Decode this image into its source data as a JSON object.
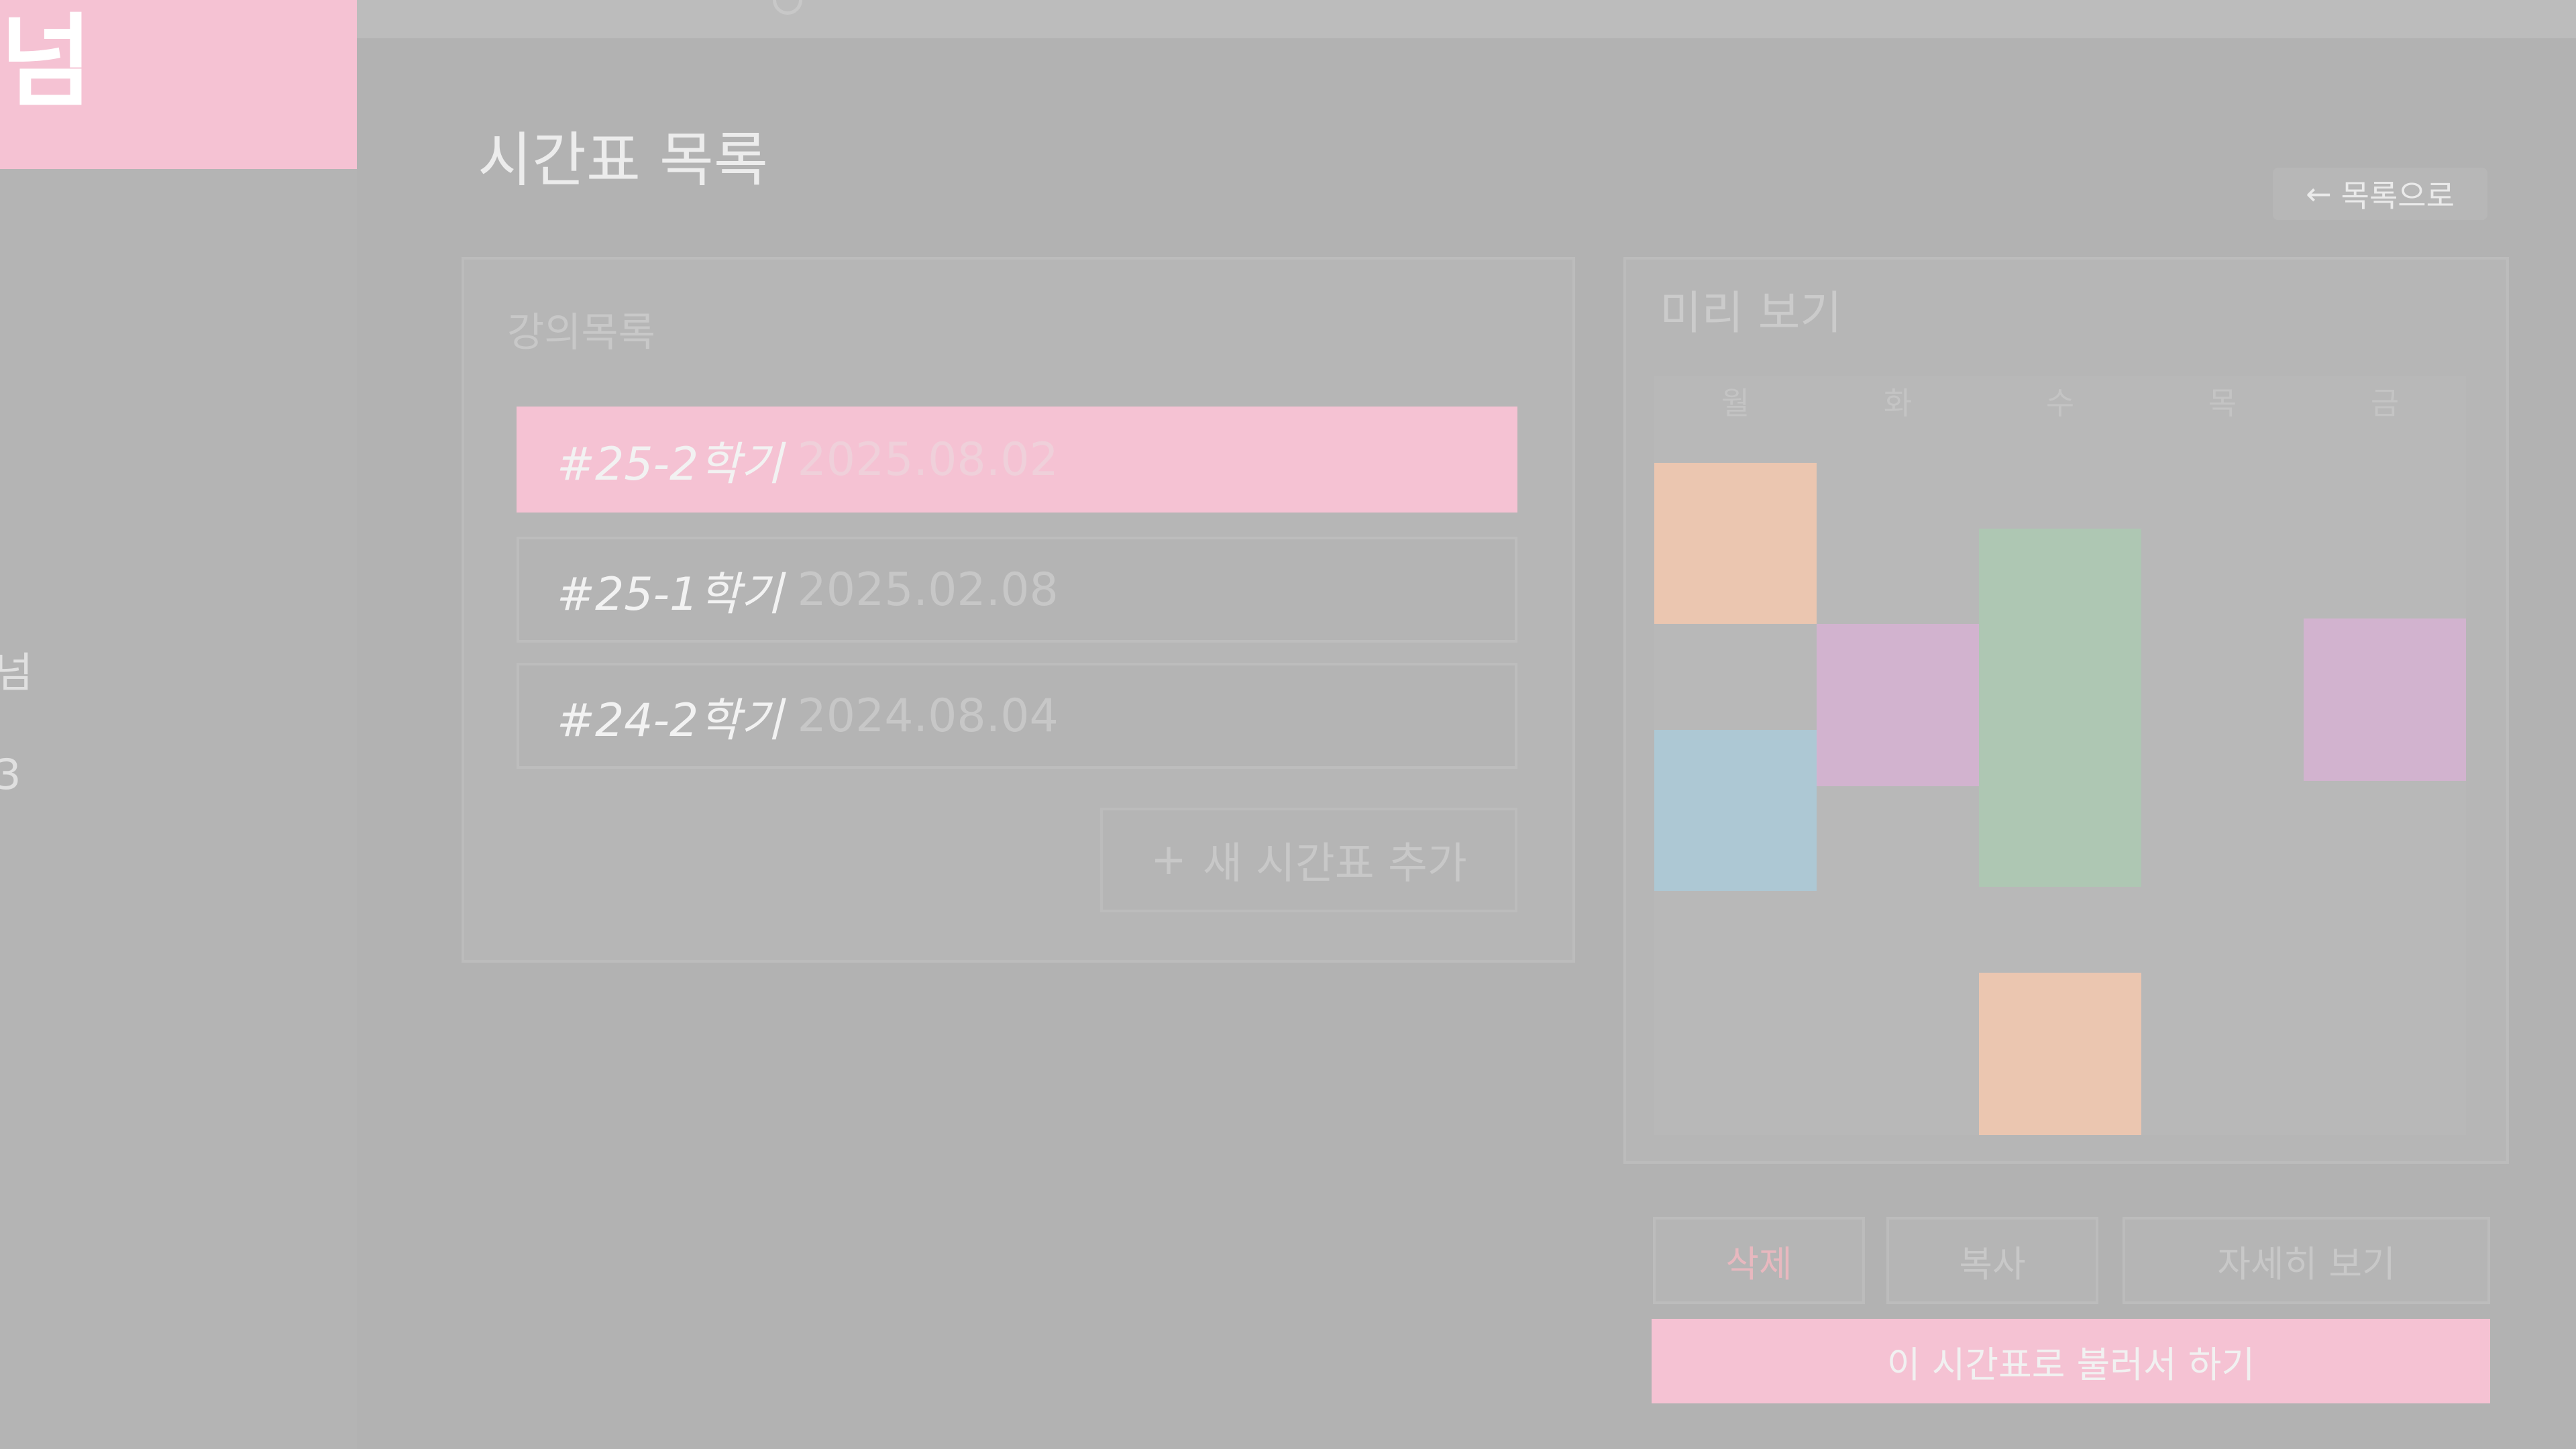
{
  "app": {
    "logo": "넘"
  },
  "sidebar": {
    "items": [
      {
        "label": "넘"
      },
      {
        "label": "3"
      }
    ]
  },
  "page": {
    "title": "시간표 목록",
    "back_icon": "←",
    "back_label": "목록으로"
  },
  "list": {
    "title": "강의목록",
    "items": [
      {
        "name": "#25-2학기",
        "date": "2025.08.02",
        "active": true
      },
      {
        "name": "#25-1학기",
        "date": "2025.02.08",
        "active": false
      },
      {
        "name": "#24-2학기",
        "date": "2024.08.04",
        "active": false
      }
    ],
    "add_icon": "+",
    "add_label": "새 시간표 추가"
  },
  "preview": {
    "title": "미리 보기",
    "days": [
      "월",
      "화",
      "수",
      "목",
      "금"
    ],
    "colors": {
      "peach": "#ebc6b0",
      "blue": "#adc8d4",
      "lavender": "#d2b3cf",
      "green": "#aec7b3"
    }
  },
  "actions": {
    "delete_label": "삭제",
    "copy_label": "복사",
    "detail_label": "자세히 보기",
    "start_label": "이 시간표로 불러서 하기"
  }
}
